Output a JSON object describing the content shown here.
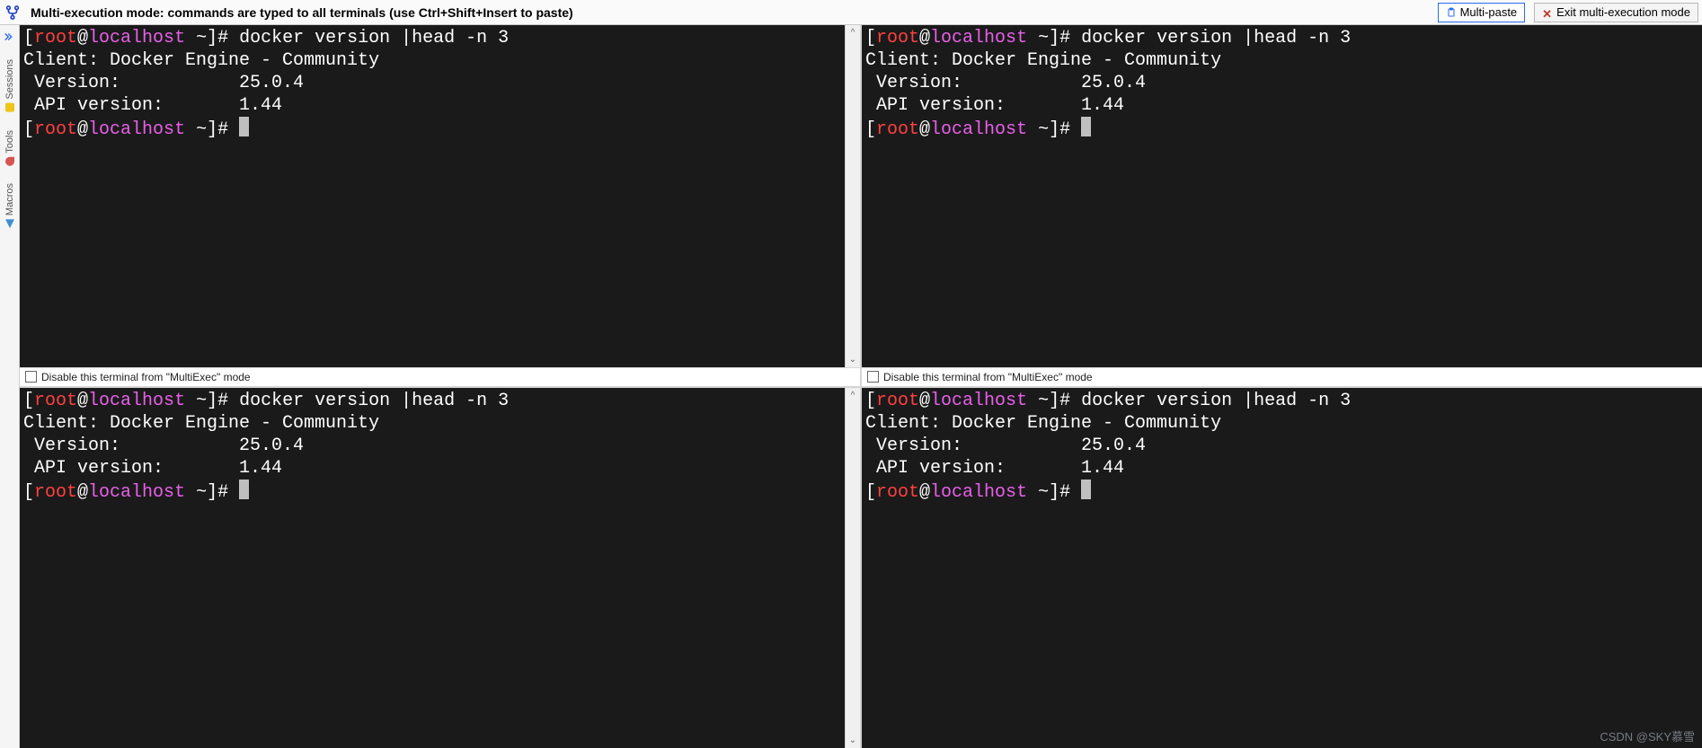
{
  "topbar": {
    "title": "Multi-execution mode: commands are typed to all terminals (use Ctrl+Shift+Insert to paste)",
    "multi_paste": "Multi-paste",
    "exit_label": "Exit multi-execution mode"
  },
  "sidebar": {
    "tabs": [
      "Sessions",
      "Tools",
      "Macros"
    ]
  },
  "terminal": {
    "prompt": {
      "open": "[",
      "user": "root",
      "at": "@",
      "host": "localhost",
      "path": " ~",
      "close": "]# "
    },
    "command": "docker version |head -n 3",
    "output": {
      "line1": "Client: Docker Engine - Community",
      "line2": " Version:           25.0.4",
      "line3": " API version:       1.44"
    }
  },
  "pane_footer": {
    "checkbox_label": "Disable this terminal from \"MultiExec\" mode"
  },
  "watermark": "CSDN @SKY慕雪"
}
